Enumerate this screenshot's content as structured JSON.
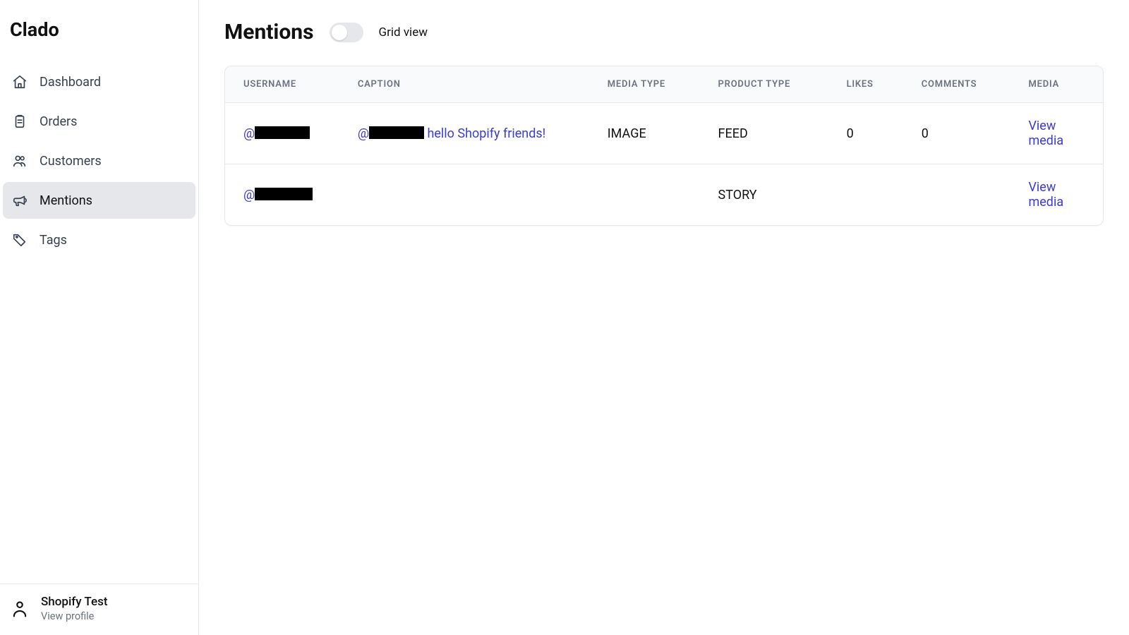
{
  "brand": "Clado",
  "sidebar": {
    "items": [
      {
        "label": "Dashboard"
      },
      {
        "label": "Orders"
      },
      {
        "label": "Customers"
      },
      {
        "label": "Mentions"
      },
      {
        "label": "Tags"
      }
    ]
  },
  "user": {
    "name": "Shopify Test",
    "sub": "View profile"
  },
  "header": {
    "title": "Mentions",
    "toggle_label": "Grid view"
  },
  "table": {
    "columns": {
      "username": "USERNAME",
      "caption": "CAPTION",
      "media_type": "MEDIA TYPE",
      "product_type": "PRODUCT TYPE",
      "likes": "LIKES",
      "comments": "COMMENTS",
      "media": "MEDIA"
    },
    "rows": [
      {
        "username_prefix": "@",
        "caption_prefix": "@",
        "caption_text": " hello Shopify friends!",
        "media_type": "IMAGE",
        "product_type": "FEED",
        "likes": "0",
        "comments": "0",
        "media_link": "View media"
      },
      {
        "username_prefix": "@",
        "caption_prefix": "",
        "caption_text": "",
        "media_type": "",
        "product_type": "STORY",
        "likes": "",
        "comments": "",
        "media_link": "View media"
      }
    ]
  }
}
